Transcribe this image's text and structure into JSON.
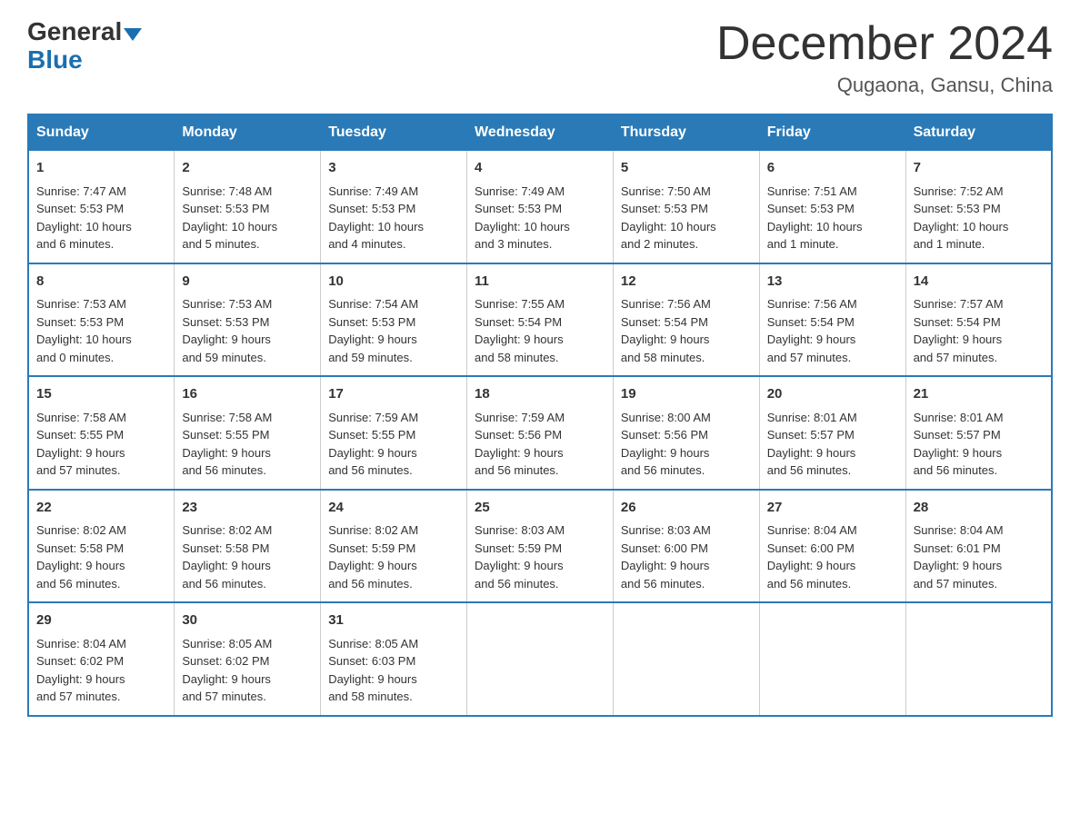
{
  "logo": {
    "general": "General",
    "blue": "Blue"
  },
  "title": "December 2024",
  "subtitle": "Qugaona, Gansu, China",
  "header_days": [
    "Sunday",
    "Monday",
    "Tuesday",
    "Wednesday",
    "Thursday",
    "Friday",
    "Saturday"
  ],
  "weeks": [
    [
      {
        "day": "1",
        "sunrise": "7:47 AM",
        "sunset": "5:53 PM",
        "daylight": "10 hours and 6 minutes."
      },
      {
        "day": "2",
        "sunrise": "7:48 AM",
        "sunset": "5:53 PM",
        "daylight": "10 hours and 5 minutes."
      },
      {
        "day": "3",
        "sunrise": "7:49 AM",
        "sunset": "5:53 PM",
        "daylight": "10 hours and 4 minutes."
      },
      {
        "day": "4",
        "sunrise": "7:49 AM",
        "sunset": "5:53 PM",
        "daylight": "10 hours and 3 minutes."
      },
      {
        "day": "5",
        "sunrise": "7:50 AM",
        "sunset": "5:53 PM",
        "daylight": "10 hours and 2 minutes."
      },
      {
        "day": "6",
        "sunrise": "7:51 AM",
        "sunset": "5:53 PM",
        "daylight": "10 hours and 1 minute."
      },
      {
        "day": "7",
        "sunrise": "7:52 AM",
        "sunset": "5:53 PM",
        "daylight": "10 hours and 1 minute."
      }
    ],
    [
      {
        "day": "8",
        "sunrise": "7:53 AM",
        "sunset": "5:53 PM",
        "daylight": "10 hours and 0 minutes."
      },
      {
        "day": "9",
        "sunrise": "7:53 AM",
        "sunset": "5:53 PM",
        "daylight": "9 hours and 59 minutes."
      },
      {
        "day": "10",
        "sunrise": "7:54 AM",
        "sunset": "5:53 PM",
        "daylight": "9 hours and 59 minutes."
      },
      {
        "day": "11",
        "sunrise": "7:55 AM",
        "sunset": "5:54 PM",
        "daylight": "9 hours and 58 minutes."
      },
      {
        "day": "12",
        "sunrise": "7:56 AM",
        "sunset": "5:54 PM",
        "daylight": "9 hours and 58 minutes."
      },
      {
        "day": "13",
        "sunrise": "7:56 AM",
        "sunset": "5:54 PM",
        "daylight": "9 hours and 57 minutes."
      },
      {
        "day": "14",
        "sunrise": "7:57 AM",
        "sunset": "5:54 PM",
        "daylight": "9 hours and 57 minutes."
      }
    ],
    [
      {
        "day": "15",
        "sunrise": "7:58 AM",
        "sunset": "5:55 PM",
        "daylight": "9 hours and 57 minutes."
      },
      {
        "day": "16",
        "sunrise": "7:58 AM",
        "sunset": "5:55 PM",
        "daylight": "9 hours and 56 minutes."
      },
      {
        "day": "17",
        "sunrise": "7:59 AM",
        "sunset": "5:55 PM",
        "daylight": "9 hours and 56 minutes."
      },
      {
        "day": "18",
        "sunrise": "7:59 AM",
        "sunset": "5:56 PM",
        "daylight": "9 hours and 56 minutes."
      },
      {
        "day": "19",
        "sunrise": "8:00 AM",
        "sunset": "5:56 PM",
        "daylight": "9 hours and 56 minutes."
      },
      {
        "day": "20",
        "sunrise": "8:01 AM",
        "sunset": "5:57 PM",
        "daylight": "9 hours and 56 minutes."
      },
      {
        "day": "21",
        "sunrise": "8:01 AM",
        "sunset": "5:57 PM",
        "daylight": "9 hours and 56 minutes."
      }
    ],
    [
      {
        "day": "22",
        "sunrise": "8:02 AM",
        "sunset": "5:58 PM",
        "daylight": "9 hours and 56 minutes."
      },
      {
        "day": "23",
        "sunrise": "8:02 AM",
        "sunset": "5:58 PM",
        "daylight": "9 hours and 56 minutes."
      },
      {
        "day": "24",
        "sunrise": "8:02 AM",
        "sunset": "5:59 PM",
        "daylight": "9 hours and 56 minutes."
      },
      {
        "day": "25",
        "sunrise": "8:03 AM",
        "sunset": "5:59 PM",
        "daylight": "9 hours and 56 minutes."
      },
      {
        "day": "26",
        "sunrise": "8:03 AM",
        "sunset": "6:00 PM",
        "daylight": "9 hours and 56 minutes."
      },
      {
        "day": "27",
        "sunrise": "8:04 AM",
        "sunset": "6:00 PM",
        "daylight": "9 hours and 56 minutes."
      },
      {
        "day": "28",
        "sunrise": "8:04 AM",
        "sunset": "6:01 PM",
        "daylight": "9 hours and 57 minutes."
      }
    ],
    [
      {
        "day": "29",
        "sunrise": "8:04 AM",
        "sunset": "6:02 PM",
        "daylight": "9 hours and 57 minutes."
      },
      {
        "day": "30",
        "sunrise": "8:05 AM",
        "sunset": "6:02 PM",
        "daylight": "9 hours and 57 minutes."
      },
      {
        "day": "31",
        "sunrise": "8:05 AM",
        "sunset": "6:03 PM",
        "daylight": "9 hours and 58 minutes."
      },
      null,
      null,
      null,
      null
    ]
  ],
  "labels": {
    "sunrise": "Sunrise:",
    "sunset": "Sunset:",
    "daylight": "Daylight:"
  }
}
